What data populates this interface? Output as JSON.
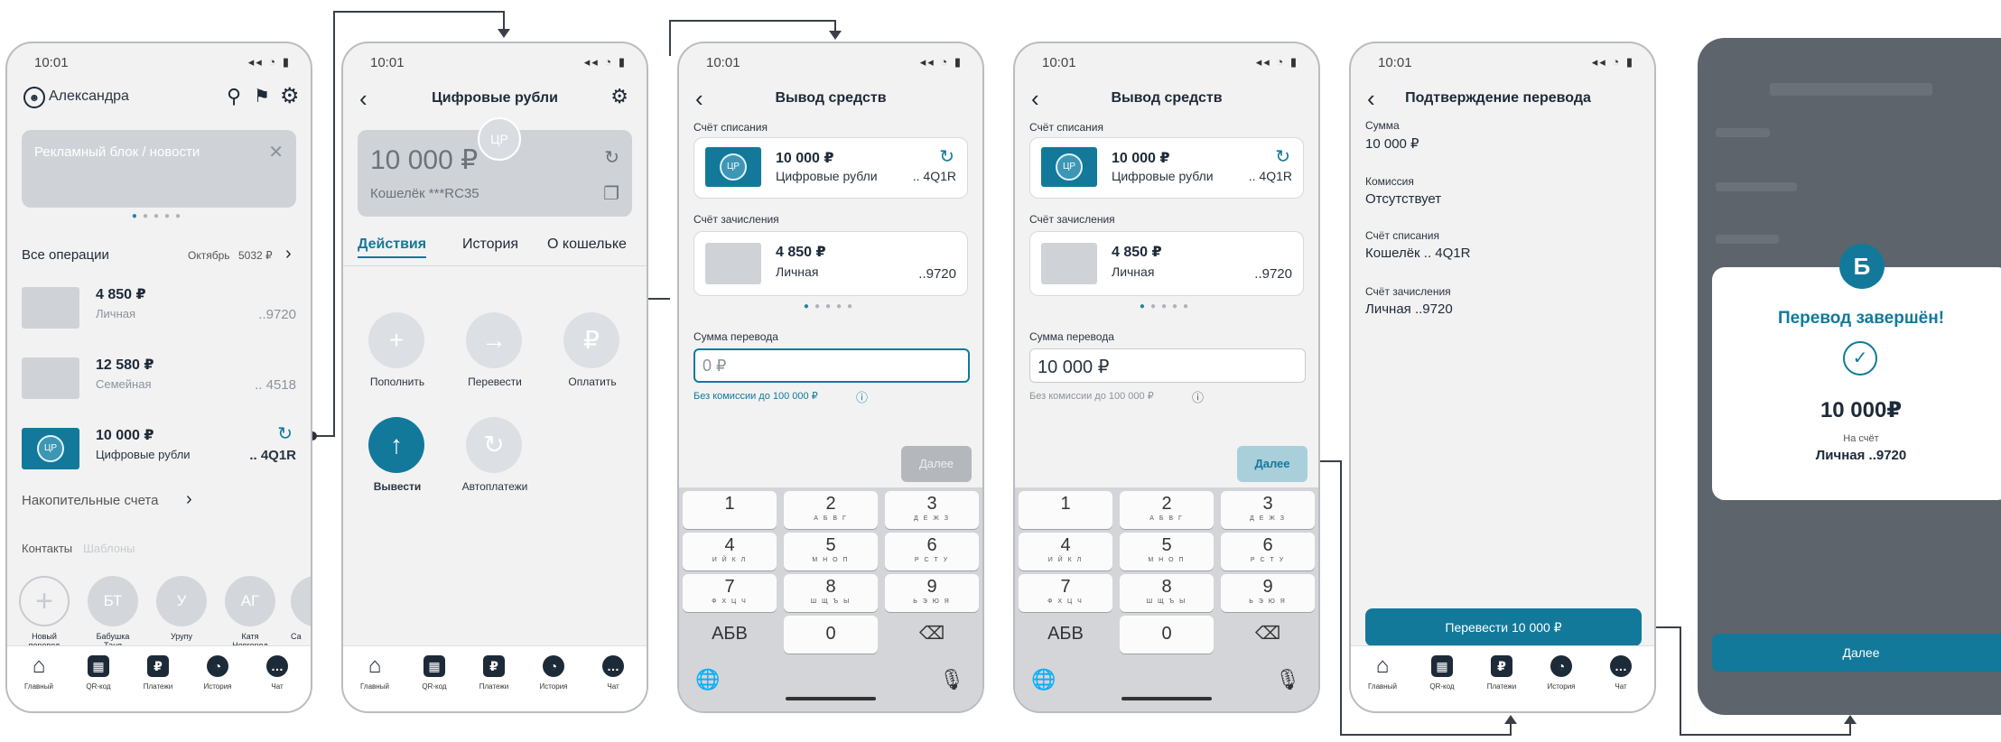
{
  "status_time": "10:01",
  "status_icons": "◂◂ ◔ ▮",
  "tabbar": [
    {
      "label": "Главный",
      "glyph": "⌂"
    },
    {
      "label": "QR-код",
      "glyph": "▦"
    },
    {
      "label": "Платежи",
      "glyph": "₽"
    },
    {
      "label": "История",
      "glyph": "◔"
    },
    {
      "label": "Чат",
      "glyph": "…"
    }
  ],
  "screen1": {
    "user": "Александра",
    "banner": "Рекламный блок / новости",
    "all_ops": "Все операции",
    "month": "Октябрь",
    "month_sum": "5032 ₽",
    "accounts": [
      {
        "amount": "4 850 ₽",
        "name": "Личная",
        "suffix": "..9720"
      },
      {
        "amount": "12 580 ₽",
        "name": "Семейная",
        "suffix": ".. 4518"
      },
      {
        "amount": "10 000 ₽",
        "name": "Цифровые рубли",
        "suffix": ".. 4Q1R",
        "badge": "ЦР"
      }
    ],
    "savings": "Накопительные счета",
    "contacts_tab": "Контакты",
    "templates_tab": "Шаблоны",
    "contacts": [
      {
        "initials": "+",
        "name": "Новый"
      },
      {
        "initials": "БТ",
        "name": "Бабушка"
      },
      {
        "initials": "У",
        "name": "Урупу"
      },
      {
        "initials": "АГ",
        "name": "Катя"
      },
      {
        "initials": "",
        "name": "Са"
      }
    ],
    "contacts_second_line": [
      "перевод",
      "Таня",
      "",
      "Новгород"
    ]
  },
  "screen2": {
    "title": "Цифровые рубли",
    "badge": "ЦР",
    "amount": "10 000 ₽",
    "wallet": "Кошелёк ***RC35",
    "tabs": [
      "Действия",
      "История",
      "О кошельке"
    ],
    "actions": [
      {
        "label": "Пополнить",
        "glyph": "+"
      },
      {
        "label": "Перевести",
        "glyph": "→"
      },
      {
        "label": "Оплатить",
        "glyph": "₽"
      },
      {
        "label": "Вывести",
        "glyph": "↑"
      },
      {
        "label": "Автоплатежи",
        "glyph": "↻"
      }
    ]
  },
  "withdraw": {
    "title": "Вывод средств",
    "from_label": "Счёт списания",
    "from_amount": "10 000 ₽",
    "from_name": "Цифровые рубли",
    "from_suffix": ".. 4Q1R",
    "from_badge": "ЦР",
    "to_label": "Счёт зачисления",
    "to_amount": "4 850 ₽",
    "to_name": "Личная",
    "to_suffix": "..9720",
    "sum_label": "Сумма перевода",
    "sum_empty": "0 ₽",
    "sum_filled": "10 000 ₽",
    "hint": "Без комиссии до 100 000 ₽",
    "next": "Далее"
  },
  "keypad": [
    {
      "n": "1",
      "l": ""
    },
    {
      "n": "2",
      "l": "А Б В Г"
    },
    {
      "n": "3",
      "l": "Д Е Ж З"
    },
    {
      "n": "4",
      "l": "И Й К Л"
    },
    {
      "n": "5",
      "l": "М Н О П"
    },
    {
      "n": "6",
      "l": "Р С Т У"
    },
    {
      "n": "7",
      "l": "Ф Х Ц Ч"
    },
    {
      "n": "8",
      "l": "Ш Щ Ъ Ы"
    },
    {
      "n": "9",
      "l": "Ь Э Ю Я"
    },
    {
      "n": "АБВ",
      "l": ""
    },
    {
      "n": "0",
      "l": ""
    },
    {
      "n": "⌫",
      "l": ""
    }
  ],
  "confirm": {
    "title": "Подтверждение перевода",
    "rows": [
      {
        "label": "Сумма",
        "value": "10 000 ₽"
      },
      {
        "label": "Комиссия",
        "value": "Отсутствует"
      },
      {
        "label": "Счёт списания",
        "value": "Кошелёк .. 4Q1R"
      },
      {
        "label": "Счёт зачисления",
        "value": "Личная ..9720"
      }
    ],
    "button": "Перевести 10 000 ₽"
  },
  "done": {
    "letter": "Б",
    "title": "Перевод завершён!",
    "amount": "10 000₽",
    "to_label": "На счёт",
    "to_value": "Личная ..9720",
    "button": "Далее"
  },
  "colors": {
    "accent": "#12799b",
    "dark": "#1d2a38",
    "overlay": "#5e646b"
  }
}
